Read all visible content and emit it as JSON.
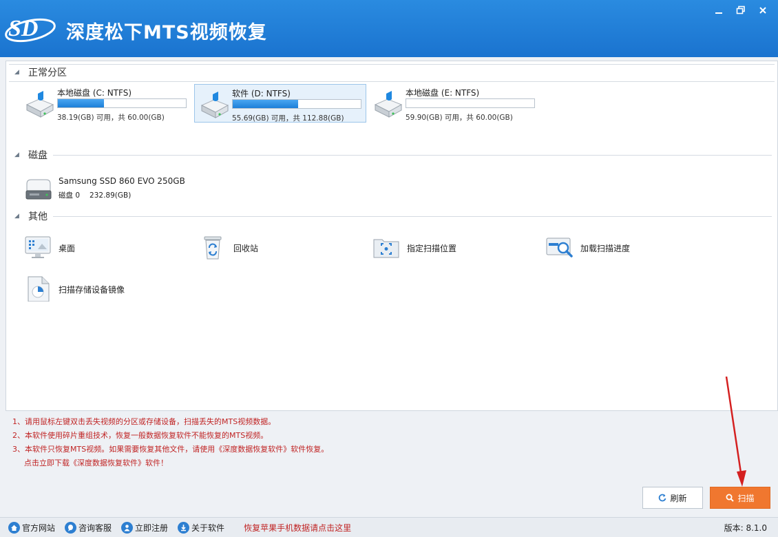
{
  "app": {
    "title": "深度松下MTS视频恢复"
  },
  "window_controls": {
    "minimize": "—",
    "restore": "❐",
    "close": "✕"
  },
  "sections": {
    "normal_partitions": "正常分区",
    "disks": "磁盘",
    "other": "其他"
  },
  "partitions": [
    {
      "name": "本地磁盘 (C: NTFS)",
      "info": "38.19(GB) 可用，共 60.00(GB)",
      "used_fraction": 0.36,
      "selected": false
    },
    {
      "name": "软件 (D: NTFS)",
      "info": "55.69(GB) 可用，共 112.88(GB)",
      "used_fraction": 0.51,
      "selected": true
    },
    {
      "name": "本地磁盘 (E: NTFS)",
      "info": "59.90(GB) 可用，共 60.00(GB)",
      "used_fraction": 0.0,
      "selected": false
    }
  ],
  "disk": {
    "name": "Samsung SSD 860 EVO 250GB",
    "index": "磁盘 0",
    "size": "232.89(GB)"
  },
  "other_items": [
    {
      "label": "桌面",
      "icon": "desktop-icon"
    },
    {
      "label": "回收站",
      "icon": "recycle-bin-icon"
    },
    {
      "label": "指定扫描位置",
      "icon": "folder-scan-icon"
    },
    {
      "label": "加载扫描进度",
      "icon": "load-progress-icon"
    },
    {
      "label": "扫描存储设备镜像",
      "icon": "image-file-icon"
    }
  ],
  "notes": {
    "line1": "1、请用鼠标左键双击丢失视频的分区或存储设备，扫描丢失的MTS视频数据。",
    "line2": "2、本软件使用碎片重组技术，恢复一般数据恢复软件不能恢复的MTS视频。",
    "line3": "3、本软件只恢复MTS视频。如果需要恢复其他文件，请使用《深度数据恢复软件》软件恢复。",
    "download_link": "点击立即下载《深度数据恢复软件》软件！"
  },
  "buttons": {
    "refresh": "刷新",
    "scan": "扫描"
  },
  "footer": {
    "official_site": "官方网站",
    "support": "咨询客服",
    "register": "立即注册",
    "about": "关于软件",
    "apple_link": "恢复苹果手机数据请点击这里",
    "version": "版本: 8.1.0"
  },
  "colors": {
    "accent": "#1a73cf",
    "scan_button": "#f0772f",
    "note_text": "#c02424",
    "annotation_arrow": "#d42020"
  }
}
